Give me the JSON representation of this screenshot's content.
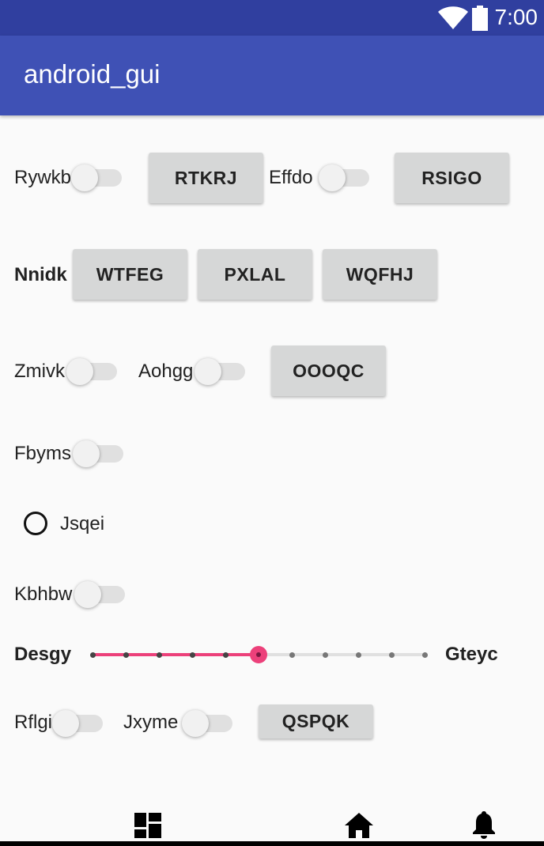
{
  "status_bar": {
    "time": "7:00",
    "icons": [
      "wifi-icon",
      "battery-icon"
    ]
  },
  "app_bar": {
    "title": "android_gui"
  },
  "rows": {
    "r1": {
      "label1": "Rywkb",
      "button1": "RTKRJ",
      "label2": "Effdo",
      "button2": "RSIGO"
    },
    "r2": {
      "label": "Nnidk",
      "button1": "WTFEG",
      "button2": "PXLAL",
      "button3": "WQFHJ"
    },
    "r3": {
      "label1": "Zmivk",
      "label2": "Aohgg",
      "button": "OOOQC"
    },
    "r4": {
      "label": "Fbyms"
    },
    "r5": {
      "radio_label": "Jsqei"
    },
    "r6": {
      "label": "Kbhbw"
    },
    "r7": {
      "label_left": "Desgy",
      "label_right": "Gteyc",
      "slider": {
        "steps": 10,
        "value": 5,
        "accent": "#ec407a"
      }
    },
    "r8": {
      "label1": "Rflgi",
      "label2": "Jxyme",
      "button": "QSPQK"
    }
  },
  "switch_states": {
    "rywkb": false,
    "effdo": false,
    "zmivk": false,
    "aohgg": false,
    "fbyms": false,
    "kbhbw": false,
    "rflgi": false,
    "jxyme": false
  },
  "radio_checked": false,
  "bottom_nav": {
    "icons": [
      "dashboard-icon",
      "home-icon",
      "notifications-icon"
    ]
  },
  "colors": {
    "status_bar": "#303f9f",
    "app_bar": "#3f51b5",
    "accent": "#ec407a",
    "background": "#fafafa",
    "button": "#d6d7d7"
  }
}
